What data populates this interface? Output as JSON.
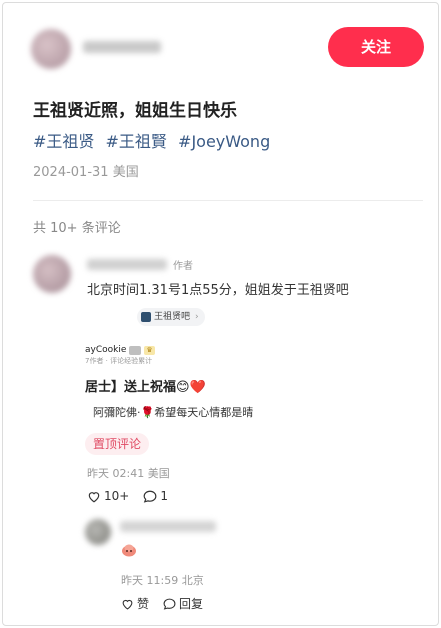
{
  "post": {
    "follow_label": "关注",
    "title": "王祖贤近照，姐姐生日快乐",
    "tags": [
      "#王祖贤",
      "#王祖賢",
      "#JoeyWong"
    ],
    "date": "2024-01-31",
    "location": "美国"
  },
  "comments": {
    "count_label": "共 10+ 条评论",
    "top": {
      "author_badge": "作者",
      "text": "北京时间1.31号1点55分，姐姐发于王祖贤吧",
      "link_chip": "王祖贤吧",
      "quoted": {
        "name": "ayCookie",
        "sub": "7作者 · 评论经验累计",
        "greeting": "居士】送上祝福😊❤️",
        "body": "阿彌陀佛·🌹希望每天心情都是晴"
      },
      "pin_label": "置顶评论",
      "time": "昨天 02:41",
      "location": "美国",
      "likes": "10+",
      "replies": "1"
    },
    "reply": {
      "time": "昨天 11:59",
      "location": "北京",
      "like_label": "赞",
      "reply_label": "回复"
    }
  },
  "colors": {
    "accent": "#ff2e4d",
    "tag": "#3a5a85",
    "pin_text": "#e04a63",
    "pin_bg": "#fdeef0"
  },
  "icons": [
    "heart-icon",
    "comment-bubble-icon",
    "chevron-right-icon",
    "sticker-icon"
  ]
}
